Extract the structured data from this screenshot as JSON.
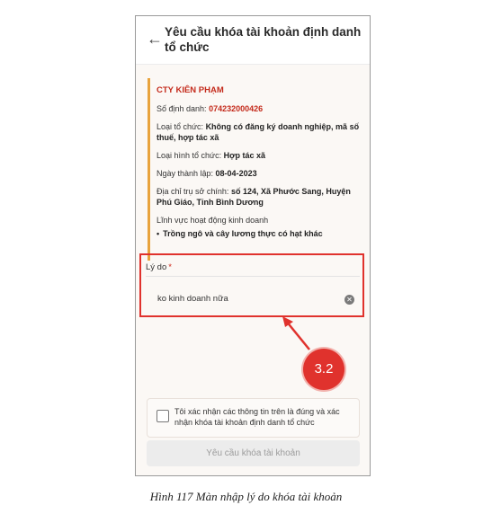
{
  "header": {
    "back_icon": "arrow-left-icon",
    "title": "Yêu cầu khóa tài khoản định danh tổ chức"
  },
  "org": {
    "name": "CTY KIÊN PHẠM",
    "id_label": "Số định danh: ",
    "id_value": "074232000426",
    "type_label": "Loại tổ chức: ",
    "type_value": "Không có đăng ký doanh nghiệp, mã số thuế, hợp tác xã",
    "kind_label": "Loại hình tổ chức: ",
    "kind_value": "Hợp tác xã",
    "date_label": "Ngày thành lập: ",
    "date_value": "08-04-2023",
    "address_label": "Địa chỉ trụ sở chính: ",
    "address_value": "số 124, Xã Phước Sang, Huyện Phú Giáo, Tỉnh Bình Dương",
    "field_label": "Lĩnh vực hoạt động kinh doanh",
    "field_items": [
      "Trồng ngô và cây lương thực có hạt khác"
    ]
  },
  "reason": {
    "label": "Lý do",
    "required_mark": "*",
    "value": "ko kinh doanh nữa",
    "clear_icon": "clear-circle-icon"
  },
  "annotation": {
    "step": "3.2",
    "color": "#e0322d"
  },
  "confirm": {
    "text": "Tôi xác nhận các thông tin trên là đúng và xác nhận khóa tài khoản định danh tổ chức",
    "checked": false
  },
  "submit": {
    "label": "Yêu cầu khóa tài khoản"
  },
  "caption": "Hình 117 Màn nhập lý do khóa tài khoản"
}
